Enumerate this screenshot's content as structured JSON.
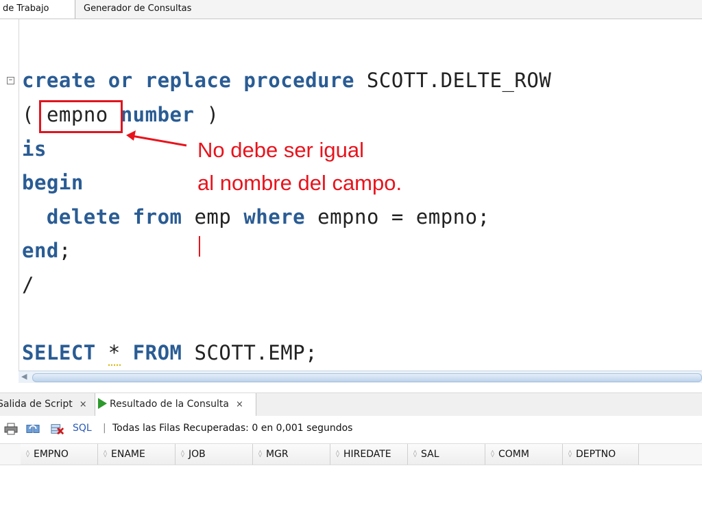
{
  "top_tabs": [
    "de Trabajo",
    "Generador de Consultas"
  ],
  "editor": {
    "fold_symbol": "⊟",
    "lines": [
      {
        "kw1": "create",
        "kw2": "or",
        "kw3": "replace",
        "kw4": "procedure",
        "rest": "SCOTT.DELTE_ROW"
      },
      {
        "open": "(",
        "param": "empno",
        "type": "number",
        "close": ")"
      },
      {
        "kw": "is"
      },
      {
        "kw": "begin"
      },
      {
        "kw1": "delete",
        "kw2": "from",
        "tbl": "emp",
        "kw3": "where",
        "cond": "empno = empno;"
      },
      {
        "kw": "end",
        "tail": ";"
      },
      {
        "text": "/"
      },
      {
        "kw1": "SELECT",
        "star": "*",
        "kw2": "FROM",
        "rest": "SCOTT.EMP;"
      }
    ],
    "annotation": {
      "line1": "No debe ser igual",
      "line2": "al nombre del campo.",
      "color": "#e8131c"
    }
  },
  "results": {
    "tabs": [
      {
        "label": "Salida de Script",
        "close": "×"
      },
      {
        "label": "Resultado de la Consulta",
        "close": "×"
      }
    ],
    "toolbar": {
      "sql_label": "SQL",
      "separator": "|",
      "status": "Todas las Filas Recuperadas: 0 en 0,001 segundos"
    },
    "columns": [
      "EMPNO",
      "ENAME",
      "JOB",
      "MGR",
      "HIREDATE",
      "SAL",
      "COMM",
      "DEPTNO"
    ]
  },
  "colors": {
    "keyword": "#2a5c94",
    "accent_red": "#e0141e",
    "run_green": "#2c9a2c",
    "link_blue": "#2859b8"
  }
}
